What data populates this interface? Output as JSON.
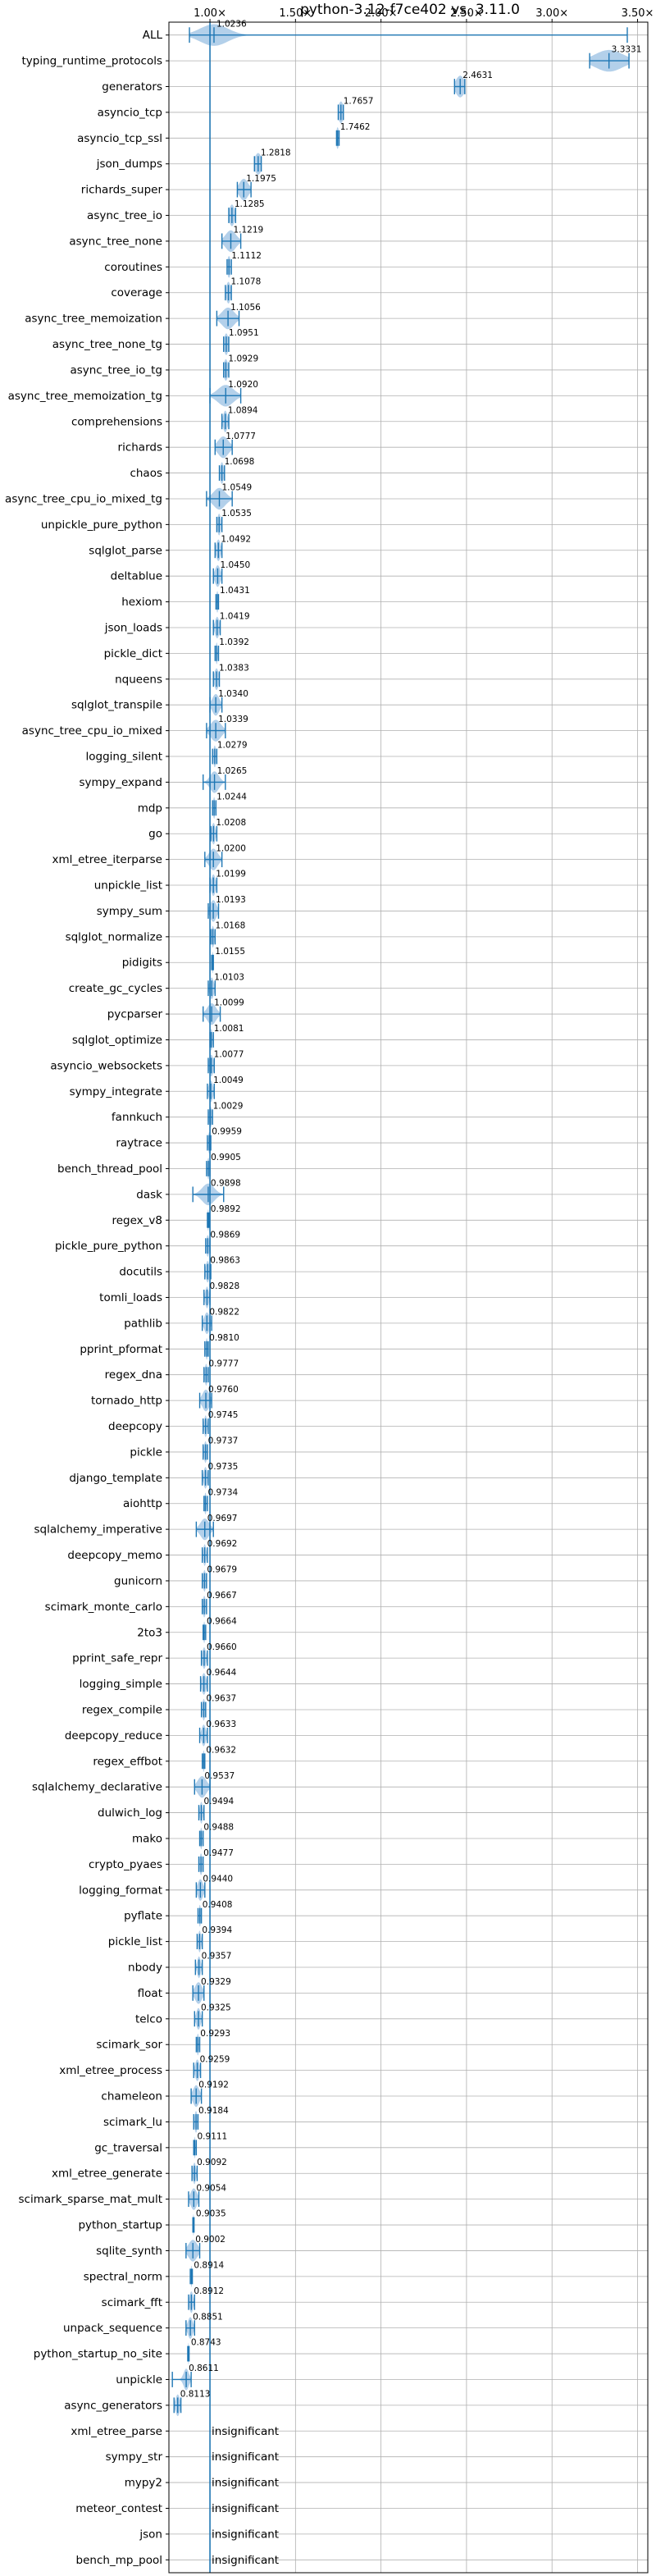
{
  "chart_data": {
    "type": "violin",
    "title": "python-3.12-f7ce402 vs. 3.11.0",
    "x_ticks": [
      "1.00×",
      "1.50×",
      "2.00×",
      "2.50×",
      "3.00×",
      "3.50×"
    ],
    "x_tick_values": [
      1.0,
      1.5,
      2.0,
      2.5,
      3.0,
      3.5
    ],
    "xlim": [
      0.76,
      3.56
    ],
    "reference_line": 1.0,
    "grid": true,
    "insignificant_label": "insignificant",
    "colors": {
      "body": "#a6c8e6",
      "line": "#1f77b4",
      "grid": "#b0b0b0"
    },
    "benchmarks": [
      {
        "name": "ALL",
        "value": 1.0236,
        "label": "1.0236",
        "min": 0.88,
        "max": 3.44,
        "spread": 0.08
      },
      {
        "name": "typing_runtime_protocols",
        "value": 3.3331,
        "label": "3.3331",
        "min": 3.22,
        "max": 3.45,
        "spread": 0.08
      },
      {
        "name": "generators",
        "value": 2.4631,
        "label": "2.4631",
        "min": 2.43,
        "max": 2.49,
        "spread": 0.025
      },
      {
        "name": "asyncio_tcp",
        "value": 1.7657,
        "label": "1.7657",
        "min": 1.75,
        "max": 1.78,
        "spread": 0.015
      },
      {
        "name": "asyncio_tcp_ssl",
        "value": 1.7462,
        "label": "1.7462",
        "min": 1.74,
        "max": 1.755,
        "spread": 0.008
      },
      {
        "name": "json_dumps",
        "value": 1.2818,
        "label": "1.2818",
        "min": 1.26,
        "max": 1.3,
        "spread": 0.02
      },
      {
        "name": "richards_super",
        "value": 1.1975,
        "label": "1.1975",
        "min": 1.16,
        "max": 1.24,
        "spread": 0.025
      },
      {
        "name": "async_tree_io",
        "value": 1.1285,
        "label": "1.1285",
        "min": 1.11,
        "max": 1.15,
        "spread": 0.015
      },
      {
        "name": "async_tree_none",
        "value": 1.1219,
        "label": "1.1219",
        "min": 1.07,
        "max": 1.18,
        "spread": 0.03
      },
      {
        "name": "coroutines",
        "value": 1.1112,
        "label": "1.1112",
        "min": 1.1,
        "max": 1.125,
        "spread": 0.01
      },
      {
        "name": "coverage",
        "value": 1.1078,
        "label": "1.1078",
        "min": 1.09,
        "max": 1.125,
        "spread": 0.012
      },
      {
        "name": "async_tree_memoization",
        "value": 1.1056,
        "label": "1.1056",
        "min": 1.04,
        "max": 1.17,
        "spread": 0.035
      },
      {
        "name": "async_tree_none_tg",
        "value": 1.0951,
        "label": "1.0951",
        "min": 1.08,
        "max": 1.11,
        "spread": 0.012
      },
      {
        "name": "async_tree_io_tg",
        "value": 1.0929,
        "label": "1.0929",
        "min": 1.08,
        "max": 1.11,
        "spread": 0.012
      },
      {
        "name": "async_tree_memoization_tg",
        "value": 1.092,
        "label": "1.0920",
        "min": 1.0,
        "max": 1.18,
        "spread": 0.045
      },
      {
        "name": "comprehensions",
        "value": 1.0894,
        "label": "1.0894",
        "min": 1.07,
        "max": 1.11,
        "spread": 0.012
      },
      {
        "name": "richards",
        "value": 1.0777,
        "label": "1.0777",
        "min": 1.03,
        "max": 1.13,
        "spread": 0.03
      },
      {
        "name": "chaos",
        "value": 1.0698,
        "label": "1.0698",
        "min": 1.055,
        "max": 1.085,
        "spread": 0.01
      },
      {
        "name": "async_tree_cpu_io_mixed_tg",
        "value": 1.0549,
        "label": "1.0549",
        "min": 0.98,
        "max": 1.13,
        "spread": 0.035
      },
      {
        "name": "unpickle_pure_python",
        "value": 1.0535,
        "label": "1.0535",
        "min": 1.04,
        "max": 1.07,
        "spread": 0.01
      },
      {
        "name": "sqlglot_parse",
        "value": 1.0492,
        "label": "1.0492",
        "min": 1.03,
        "max": 1.07,
        "spread": 0.012
      },
      {
        "name": "deltablue",
        "value": 1.045,
        "label": "1.0450",
        "min": 1.02,
        "max": 1.07,
        "spread": 0.015
      },
      {
        "name": "hexiom",
        "value": 1.0431,
        "label": "1.0431",
        "min": 1.035,
        "max": 1.05,
        "spread": 0.006
      },
      {
        "name": "json_loads",
        "value": 1.0419,
        "label": "1.0419",
        "min": 1.02,
        "max": 1.06,
        "spread": 0.012
      },
      {
        "name": "pickle_dict",
        "value": 1.0392,
        "label": "1.0392",
        "min": 1.03,
        "max": 1.05,
        "spread": 0.006
      },
      {
        "name": "nqueens",
        "value": 1.0383,
        "label": "1.0383",
        "min": 1.02,
        "max": 1.055,
        "spread": 0.012
      },
      {
        "name": "sqlglot_transpile",
        "value": 1.034,
        "label": "1.0340",
        "min": 1.0,
        "max": 1.07,
        "spread": 0.02
      },
      {
        "name": "async_tree_cpu_io_mixed",
        "value": 1.0339,
        "label": "1.0339",
        "min": 0.98,
        "max": 1.09,
        "spread": 0.03
      },
      {
        "name": "logging_silent",
        "value": 1.0279,
        "label": "1.0279",
        "min": 1.015,
        "max": 1.04,
        "spread": 0.008
      },
      {
        "name": "sympy_expand",
        "value": 1.0265,
        "label": "1.0265",
        "min": 0.96,
        "max": 1.09,
        "spread": 0.025
      },
      {
        "name": "mdp",
        "value": 1.0244,
        "label": "1.0244",
        "min": 1.015,
        "max": 1.035,
        "spread": 0.006
      },
      {
        "name": "go",
        "value": 1.0208,
        "label": "1.0208",
        "min": 1.005,
        "max": 1.04,
        "spread": 0.01
      },
      {
        "name": "xml_etree_iterparse",
        "value": 1.02,
        "label": "1.0200",
        "min": 0.97,
        "max": 1.07,
        "spread": 0.025
      },
      {
        "name": "unpickle_list",
        "value": 1.0199,
        "label": "1.0199",
        "min": 1.0,
        "max": 1.04,
        "spread": 0.012
      },
      {
        "name": "sympy_sum",
        "value": 1.0193,
        "label": "1.0193",
        "min": 0.99,
        "max": 1.05,
        "spread": 0.018
      },
      {
        "name": "sqlglot_normalize",
        "value": 1.0168,
        "label": "1.0168",
        "min": 1.005,
        "max": 1.03,
        "spread": 0.008
      },
      {
        "name": "pidigits",
        "value": 1.0155,
        "label": "1.0155",
        "min": 1.01,
        "max": 1.02,
        "spread": 0.004
      },
      {
        "name": "create_gc_cycles",
        "value": 1.0103,
        "label": "1.0103",
        "min": 0.99,
        "max": 1.03,
        "spread": 0.012
      },
      {
        "name": "pycparser",
        "value": 1.0099,
        "label": "1.0099",
        "min": 0.96,
        "max": 1.06,
        "spread": 0.025
      },
      {
        "name": "sqlglot_optimize",
        "value": 1.0081,
        "label": "1.0081",
        "min": 1.0,
        "max": 1.02,
        "spread": 0.006
      },
      {
        "name": "asyncio_websockets",
        "value": 1.0077,
        "label": "1.0077",
        "min": 0.99,
        "max": 1.025,
        "spread": 0.012
      },
      {
        "name": "sympy_integrate",
        "value": 1.0049,
        "label": "1.0049",
        "min": 0.985,
        "max": 1.025,
        "spread": 0.012
      },
      {
        "name": "fannkuch",
        "value": 1.0029,
        "label": "1.0029",
        "min": 0.99,
        "max": 1.015,
        "spread": 0.008
      },
      {
        "name": "raytrace",
        "value": 0.9959,
        "label": "0.9959",
        "min": 0.985,
        "max": 1.005,
        "spread": 0.006
      },
      {
        "name": "bench_thread_pool",
        "value": 0.9905,
        "label": "0.9905",
        "min": 0.98,
        "max": 1.0,
        "spread": 0.006
      },
      {
        "name": "dask",
        "value": 0.9898,
        "label": "0.9898",
        "min": 0.9,
        "max": 1.08,
        "spread": 0.035
      },
      {
        "name": "regex_v8",
        "value": 0.9892,
        "label": "0.9892",
        "min": 0.985,
        "max": 0.995,
        "spread": 0.004
      },
      {
        "name": "pickle_pure_python",
        "value": 0.9869,
        "label": "0.9869",
        "min": 0.975,
        "max": 1.0,
        "spread": 0.008
      },
      {
        "name": "docutils",
        "value": 0.9863,
        "label": "0.9863",
        "min": 0.97,
        "max": 1.005,
        "spread": 0.01
      },
      {
        "name": "tomli_loads",
        "value": 0.9828,
        "label": "0.9828",
        "min": 0.965,
        "max": 1.0,
        "spread": 0.01
      },
      {
        "name": "pathlib",
        "value": 0.9822,
        "label": "0.9822",
        "min": 0.955,
        "max": 1.01,
        "spread": 0.015
      },
      {
        "name": "pprint_pformat",
        "value": 0.981,
        "label": "0.9810",
        "min": 0.97,
        "max": 0.99,
        "spread": 0.006
      },
      {
        "name": "regex_dna",
        "value": 0.9777,
        "label": "0.9777",
        "min": 0.965,
        "max": 0.99,
        "spread": 0.008
      },
      {
        "name": "tornado_http",
        "value": 0.976,
        "label": "0.9760",
        "min": 0.94,
        "max": 1.01,
        "spread": 0.02
      },
      {
        "name": "deepcopy",
        "value": 0.9745,
        "label": "0.9745",
        "min": 0.96,
        "max": 0.99,
        "spread": 0.008
      },
      {
        "name": "pickle",
        "value": 0.9737,
        "label": "0.9737",
        "min": 0.96,
        "max": 0.985,
        "spread": 0.008
      },
      {
        "name": "django_template",
        "value": 0.9735,
        "label": "0.9735",
        "min": 0.955,
        "max": 0.99,
        "spread": 0.01
      },
      {
        "name": "aiohttp",
        "value": 0.9734,
        "label": "0.9734",
        "min": 0.965,
        "max": 0.985,
        "spread": 0.006
      },
      {
        "name": "sqlalchemy_imperative",
        "value": 0.9697,
        "label": "0.9697",
        "min": 0.92,
        "max": 1.02,
        "spread": 0.025
      },
      {
        "name": "deepcopy_memo",
        "value": 0.9692,
        "label": "0.9692",
        "min": 0.955,
        "max": 0.985,
        "spread": 0.008
      },
      {
        "name": "gunicorn",
        "value": 0.9679,
        "label": "0.9679",
        "min": 0.955,
        "max": 0.98,
        "spread": 0.008
      },
      {
        "name": "scimark_monte_carlo",
        "value": 0.9667,
        "label": "0.9667",
        "min": 0.955,
        "max": 0.98,
        "spread": 0.008
      },
      {
        "name": "2to3",
        "value": 0.9664,
        "label": "0.9664",
        "min": 0.96,
        "max": 0.975,
        "spread": 0.005
      },
      {
        "name": "pprint_safe_repr",
        "value": 0.966,
        "label": "0.9660",
        "min": 0.95,
        "max": 0.985,
        "spread": 0.01
      },
      {
        "name": "logging_simple",
        "value": 0.9644,
        "label": "0.9644",
        "min": 0.945,
        "max": 0.985,
        "spread": 0.012
      },
      {
        "name": "regex_compile",
        "value": 0.9637,
        "label": "0.9637",
        "min": 0.95,
        "max": 0.975,
        "spread": 0.008
      },
      {
        "name": "deepcopy_reduce",
        "value": 0.9633,
        "label": "0.9633",
        "min": 0.94,
        "max": 0.985,
        "spread": 0.012
      },
      {
        "name": "regex_effbot",
        "value": 0.9632,
        "label": "0.9632",
        "min": 0.955,
        "max": 0.97,
        "spread": 0.005
      },
      {
        "name": "sqlalchemy_declarative",
        "value": 0.9537,
        "label": "0.9537",
        "min": 0.91,
        "max": 1.0,
        "spread": 0.025
      },
      {
        "name": "dulwich_log",
        "value": 0.9494,
        "label": "0.9494",
        "min": 0.935,
        "max": 0.965,
        "spread": 0.008
      },
      {
        "name": "mako",
        "value": 0.9488,
        "label": "0.9488",
        "min": 0.94,
        "max": 0.96,
        "spread": 0.006
      },
      {
        "name": "crypto_pyaes",
        "value": 0.9477,
        "label": "0.9477",
        "min": 0.935,
        "max": 0.96,
        "spread": 0.008
      },
      {
        "name": "logging_format",
        "value": 0.944,
        "label": "0.9440",
        "min": 0.92,
        "max": 0.97,
        "spread": 0.015
      },
      {
        "name": "pyflate",
        "value": 0.9408,
        "label": "0.9408",
        "min": 0.93,
        "max": 0.95,
        "spread": 0.006
      },
      {
        "name": "pickle_list",
        "value": 0.9394,
        "label": "0.9394",
        "min": 0.925,
        "max": 0.955,
        "spread": 0.008
      },
      {
        "name": "nbody",
        "value": 0.9357,
        "label": "0.9357",
        "min": 0.915,
        "max": 0.955,
        "spread": 0.01
      },
      {
        "name": "float",
        "value": 0.9329,
        "label": "0.9329",
        "min": 0.9,
        "max": 0.965,
        "spread": 0.02
      },
      {
        "name": "telco",
        "value": 0.9325,
        "label": "0.9325",
        "min": 0.91,
        "max": 0.955,
        "spread": 0.012
      },
      {
        "name": "scimark_sor",
        "value": 0.9293,
        "label": "0.9293",
        "min": 0.92,
        "max": 0.94,
        "spread": 0.006
      },
      {
        "name": "xml_etree_process",
        "value": 0.9259,
        "label": "0.9259",
        "min": 0.905,
        "max": 0.945,
        "spread": 0.012
      },
      {
        "name": "chameleon",
        "value": 0.9192,
        "label": "0.9192",
        "min": 0.89,
        "max": 0.95,
        "spread": 0.018
      },
      {
        "name": "scimark_lu",
        "value": 0.9184,
        "label": "0.9184",
        "min": 0.905,
        "max": 0.93,
        "spread": 0.008
      },
      {
        "name": "gc_traversal",
        "value": 0.9111,
        "label": "0.9111",
        "min": 0.905,
        "max": 0.92,
        "spread": 0.004
      },
      {
        "name": "xml_etree_generate",
        "value": 0.9092,
        "label": "0.9092",
        "min": 0.895,
        "max": 0.925,
        "spread": 0.008
      },
      {
        "name": "scimark_sparse_mat_mult",
        "value": 0.9054,
        "label": "0.9054",
        "min": 0.875,
        "max": 0.935,
        "spread": 0.018
      },
      {
        "name": "python_startup",
        "value": 0.9035,
        "label": "0.9035",
        "min": 0.9,
        "max": 0.907,
        "spread": 0.003
      },
      {
        "name": "sqlite_synth",
        "value": 0.9002,
        "label": "0.9002",
        "min": 0.86,
        "max": 0.94,
        "spread": 0.025
      },
      {
        "name": "spectral_norm",
        "value": 0.8914,
        "label": "0.8914",
        "min": 0.885,
        "max": 0.897,
        "spread": 0.004
      },
      {
        "name": "scimark_fft",
        "value": 0.8912,
        "label": "0.8912",
        "min": 0.875,
        "max": 0.91,
        "spread": 0.01
      },
      {
        "name": "unpack_sequence",
        "value": 0.8851,
        "label": "0.8851",
        "min": 0.86,
        "max": 0.91,
        "spread": 0.014
      },
      {
        "name": "python_startup_no_site",
        "value": 0.8743,
        "label": "0.8743",
        "min": 0.87,
        "max": 0.878,
        "spread": 0.003
      },
      {
        "name": "unpickle",
        "value": 0.8611,
        "label": "0.8611",
        "min": 0.78,
        "max": 0.89,
        "spread": 0.015
      },
      {
        "name": "async_generators",
        "value": 0.8113,
        "label": "0.8113",
        "min": 0.79,
        "max": 0.83,
        "spread": 0.012
      },
      {
        "name": "xml_etree_parse",
        "insignificant": true
      },
      {
        "name": "sympy_str",
        "insignificant": true
      },
      {
        "name": "mypy2",
        "insignificant": true
      },
      {
        "name": "meteor_contest",
        "insignificant": true
      },
      {
        "name": "json",
        "insignificant": true
      },
      {
        "name": "bench_mp_pool",
        "insignificant": true
      }
    ]
  }
}
